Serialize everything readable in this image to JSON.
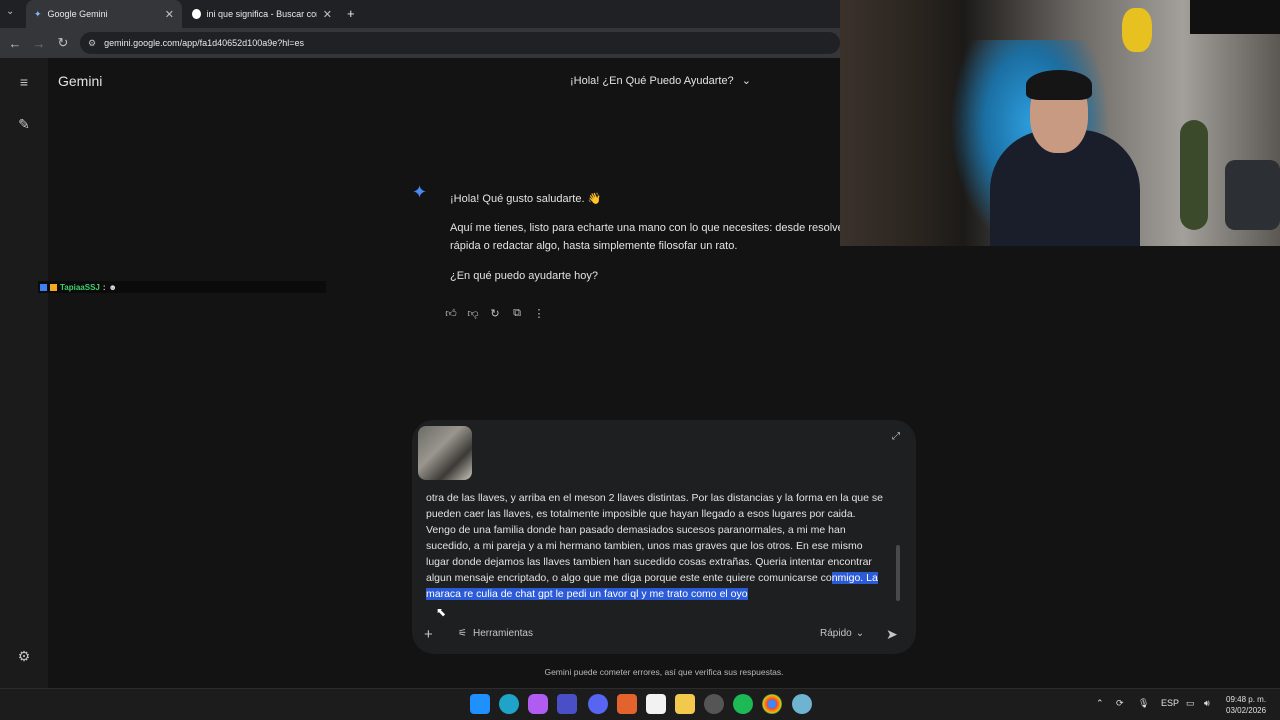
{
  "browser": {
    "tabs": [
      {
        "label": "Google Gemini",
        "active": true
      },
      {
        "label": "ini que significa - Buscar con Go",
        "active": false
      }
    ],
    "url": "gemini.google.com/app/fa1d40652d100a9e?hl=es"
  },
  "app": {
    "name": "Gemini",
    "title": "¡Hola! ¿En Qué Puedo Ayudarte?"
  },
  "response": {
    "greeting": "¡Hola! Qué gusto saludarte. 👋",
    "line1": "Aquí me tienes, listo para echarte una mano con lo que necesites: desde resolver",
    "line2": "rápida o redactar algo, hasta simplemente filosofar un rato.",
    "question": "¿En qué puedo ayudarte hoy?"
  },
  "overlay": {
    "username": "TapiaaSSJ",
    "sep": ":"
  },
  "prompt": {
    "text_plain": "otra de las llaves, y arriba en el meson 2 llaves distintas. Por las distancias y la forma en la que se pueden caer las llaves, es totalmente imposible que hayan llegado a esos lugares por caida. Vengo de una familia donde han pasado demasiados sucesos paranormales, a mi me han sucedido, a mi pareja y a mi hermano tambien, unos mas graves que los otros. En ese mismo lugar donde dejamos las llaves tambien han sucedido cosas extrañas. Queria intentar encontrar algun mensaje encriptado, o algo que me diga porque este ente quiere comunicarse co",
    "text_selected": "nmigo. La maraca re culia de chat gpt le pedi un favor ql y me trato como el oyo",
    "tools_label": "Herramientas",
    "model_label": "Rápido"
  },
  "disclaimer": "Gemini puede cometer errores, así que verifica sus respuestas.",
  "taskbar": {
    "language": "ESP",
    "time": "09:48 p. m.",
    "date": "03/02/2026"
  },
  "colors": {
    "background": "#131314",
    "input_bg": "#1e1f20",
    "selection": "#2b5bd7",
    "gemini_star": "#4a8af4"
  },
  "icons": [
    "menu-icon",
    "new-chat-icon",
    "settings-icon",
    "thumbs-up-icon",
    "thumbs-down-icon",
    "refresh-icon",
    "copy-icon",
    "more-icon",
    "expand-icon",
    "plus-icon",
    "tools-icon",
    "chevron-down-icon",
    "send-icon"
  ]
}
